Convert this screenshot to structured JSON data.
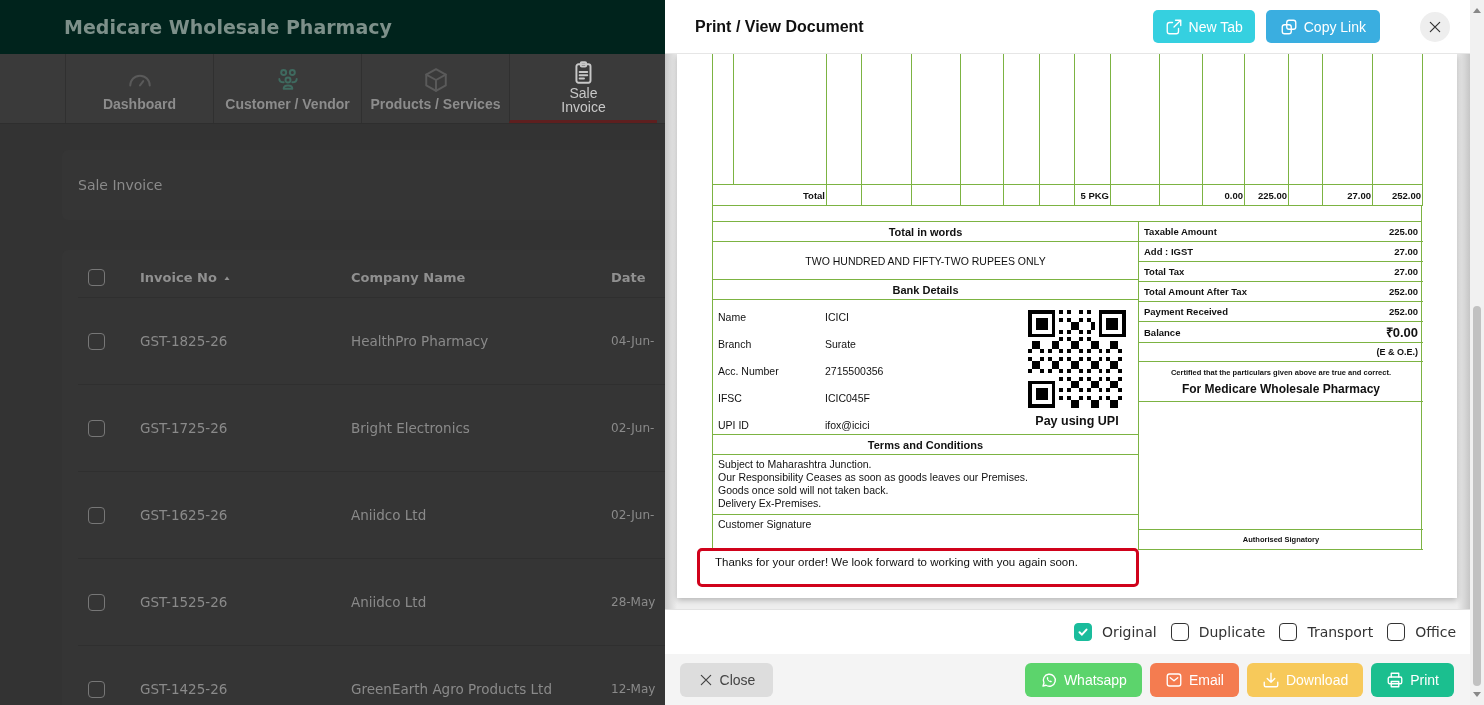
{
  "app": {
    "title": "Medicare Wholesale Pharmacy",
    "nav_tabs": [
      {
        "label": "Dashboard",
        "selected": false
      },
      {
        "label": "Customer / Vendor",
        "selected": false
      },
      {
        "label": "Products / Services",
        "selected": false
      },
      {
        "label": "Sale Invoice",
        "selected": true
      }
    ],
    "page_title": "Sale Invoice",
    "table": {
      "select_all_checked": false,
      "columns": [
        {
          "label": "Invoice No",
          "sorted": true
        },
        {
          "label": "Company Name",
          "sorted": false
        },
        {
          "label": "Date",
          "sorted": false
        }
      ],
      "rows": [
        {
          "checked": false,
          "cells": [
            "GST-1825-26",
            "HealthPro Pharmacy",
            "04-Jun-"
          ]
        },
        {
          "checked": false,
          "cells": [
            "GST-1725-26",
            "Bright Electronics",
            "02-Jun-"
          ]
        },
        {
          "checked": false,
          "cells": [
            "GST-1625-26",
            "Aniidco Ltd",
            "02-Jun-"
          ]
        },
        {
          "checked": false,
          "cells": [
            "GST-1525-26",
            "Aniidco Ltd",
            "28-May"
          ]
        },
        {
          "checked": false,
          "cells": [
            "GST-1425-26",
            "GreenEarth Agro Products Ltd",
            "12-May"
          ]
        }
      ]
    }
  },
  "modal": {
    "title": "Print / View Document",
    "header_buttons": [
      {
        "label": "New Tab"
      },
      {
        "label": "Copy Link"
      }
    ],
    "copies": [
      {
        "label": "Original",
        "checked": true
      },
      {
        "label": "Duplicate",
        "checked": false
      },
      {
        "label": "Transport",
        "checked": false
      },
      {
        "label": "Office",
        "checked": false
      }
    ],
    "close_button": "Close",
    "actions": [
      {
        "label": "Whatsapp"
      },
      {
        "label": "Email"
      },
      {
        "label": "Download"
      },
      {
        "label": "Print"
      }
    ]
  },
  "document": {
    "items_table": {
      "total_row": {
        "column_1": "Total",
        "column_9": "5 PKG",
        "column_12": "0.00",
        "column_13": "225.00",
        "column_15": "27.00",
        "column_16": "252.00"
      }
    },
    "amount_in_words": {
      "heading": "Total in words",
      "text": "TWO HUNDRED AND FIFTY-TWO RUPEES ONLY"
    },
    "bank_details": {
      "heading": "Bank Details",
      "rows": [
        {
          "label": "Name",
          "value": "ICICI"
        },
        {
          "label": "Branch",
          "value": "Surate"
        },
        {
          "label": "Acc. Number",
          "value": "2715500356"
        },
        {
          "label": "IFSC",
          "value": "ICIC045F"
        },
        {
          "label": "UPI ID",
          "value": "ifox@icici"
        }
      ],
      "qr_caption": "Pay using UPI"
    },
    "terms": {
      "heading": "Terms and Conditions",
      "lines": [
        "Subject to Maharashtra Junction.",
        "Our Responsibility Ceases as soon as goods leaves our Premises.",
        "Goods once sold will not taken back.",
        "Delivery Ex-Premises."
      ]
    },
    "customer_signature": "Customer Signature",
    "summary": [
      {
        "label": "Taxable Amount",
        "value": "225.00",
        "kind": "plain"
      },
      {
        "label": "Add : IGST",
        "value": "27.00",
        "kind": "plain"
      },
      {
        "label": "Total Tax",
        "value": "27.00",
        "kind": "plain"
      },
      {
        "label": "Total Amount After Tax",
        "value": "252.00",
        "kind": "plain"
      },
      {
        "label": "Payment Received",
        "value": "252.00",
        "kind": "plain"
      },
      {
        "label": "Balance",
        "value": "₹0.00",
        "kind": "balance"
      }
    ],
    "eoe": "(E & O.E.)",
    "certification": "Certified that the particulars given above are true and correct.",
    "signatory_for": "For Medicare Wholesale Pharmacy",
    "authorised_signatory": "Authorised Signatory",
    "thanks_note": {
      "text": "Thanks for your order! We look forward to working with you again soon.",
      "highlighted": true
    }
  }
}
